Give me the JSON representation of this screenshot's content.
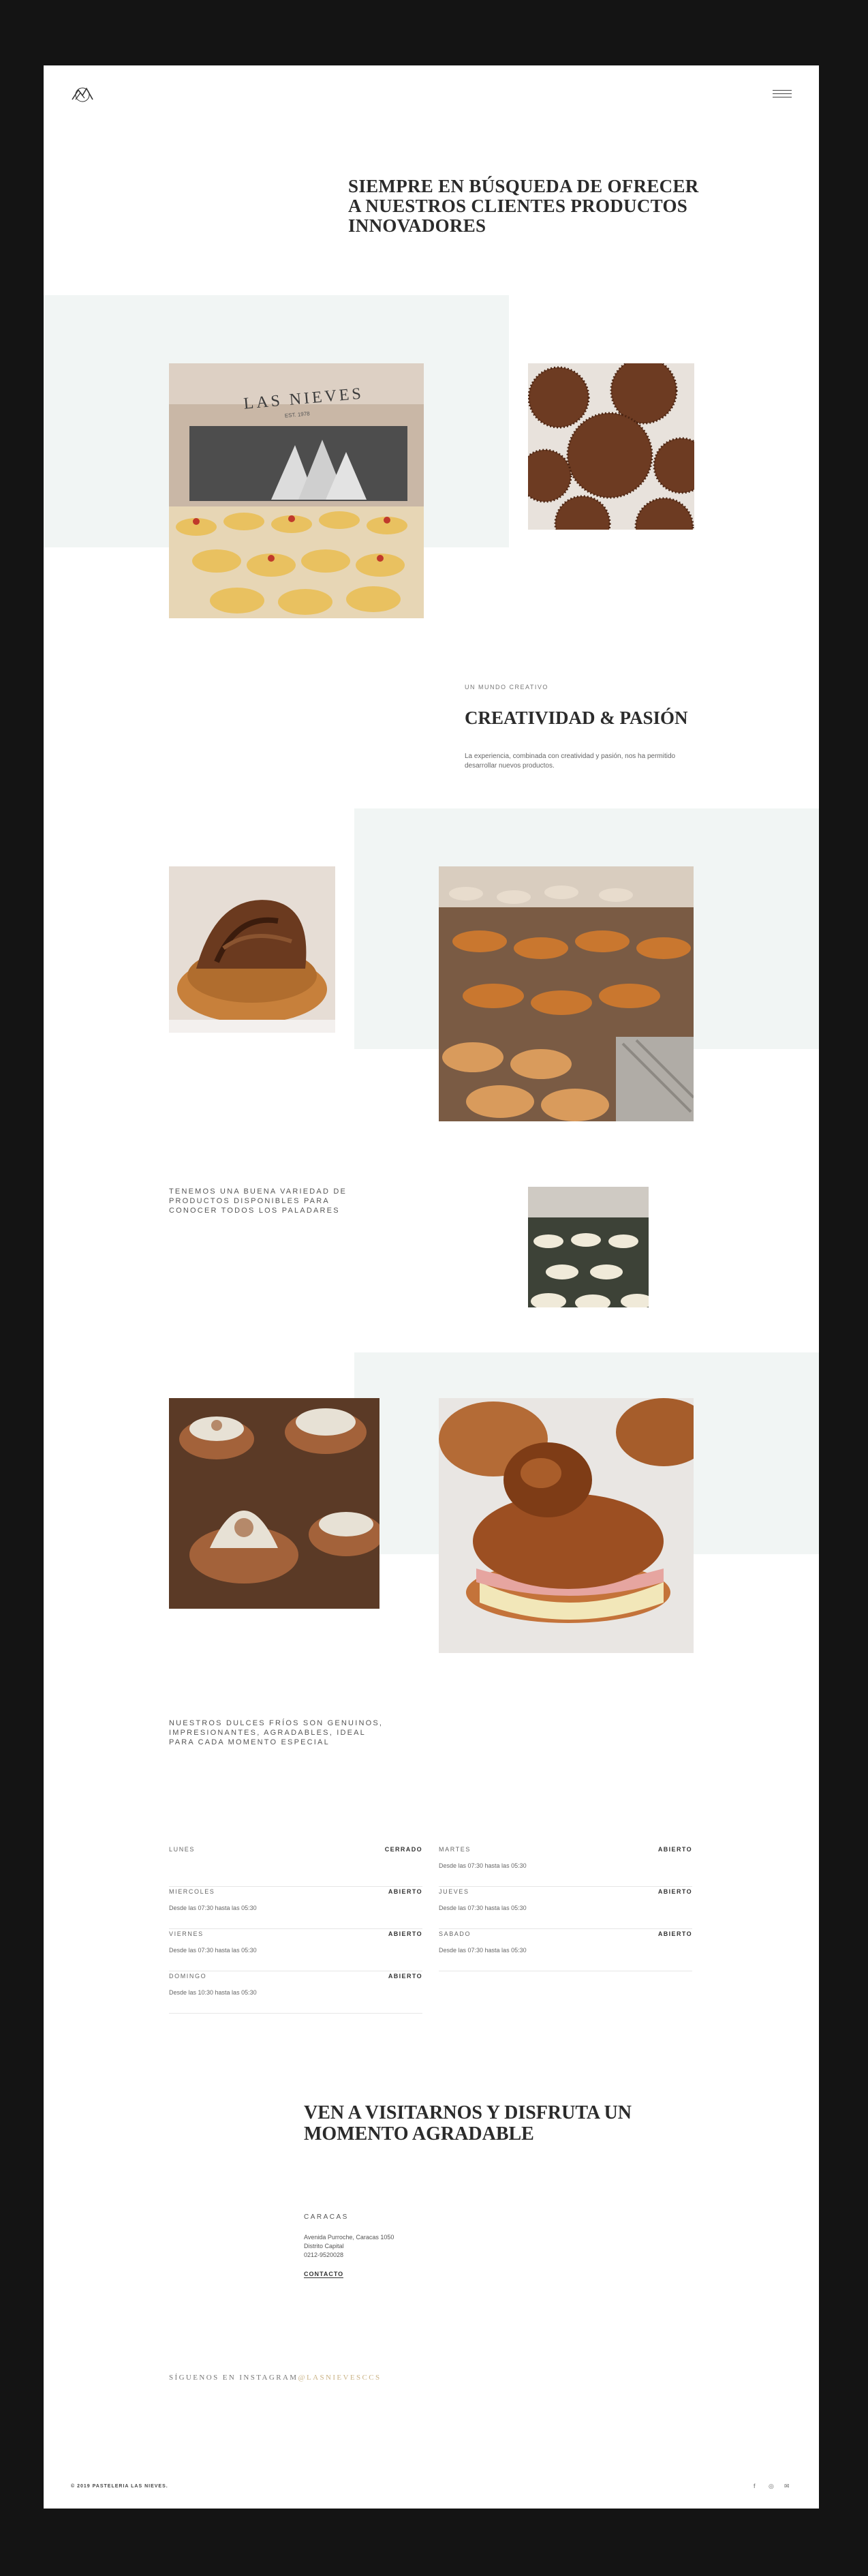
{
  "header": {
    "logo_icon": "mountain-logo-icon",
    "menu_icon": "hamburger-menu-icon"
  },
  "hero": {
    "title": "SIEMPRE EN BÚSQUEDA DE OFRECER A NUESTROS CLIENTES PRODUCTOS INNOVADORES"
  },
  "storefront_sign": {
    "name": "LAS NIEVES",
    "est": "EST. 1978"
  },
  "creative": {
    "label": "UN MUNDO CREATIVO",
    "title": "CREATIVIDAD & PASIÓN",
    "description": "La experiencia, combinada con creatividad y pasión, nos ha permitido desarrollar nuevos productos."
  },
  "variety": {
    "caption": "TENEMOS UNA BUENA VARIEDAD DE PRODUCTOS DISPONIBLES PARA CONOCER TODOS LOS PALADARES"
  },
  "cold_sweets": {
    "caption": "NUESTROS DULCES FRÍOS SON GENUINOS, IMPRESIONANTES, AGRADABLES, IDEAL PARA CADA MOMENTO ESPECIAL"
  },
  "hours": [
    {
      "day": "LUNES",
      "status": "CERRADO",
      "time": ""
    },
    {
      "day": "MARTES",
      "status": "ABIERTO",
      "time": "Desde las 07:30 hasta las 05:30"
    },
    {
      "day": "MIERCOLES",
      "status": "ABIERTO",
      "time": "Desde las 07:30 hasta las 05:30"
    },
    {
      "day": "JUEVES",
      "status": "ABIERTO",
      "time": "Desde las 07:30 hasta las 05:30"
    },
    {
      "day": "VIERNES",
      "status": "ABIERTO",
      "time": "Desde las 07:30 hasta las 05:30"
    },
    {
      "day": "SABADO",
      "status": "ABIERTO",
      "time": "Desde las 07:30 hasta las 05:30"
    },
    {
      "day": "DOMINGO",
      "status": "ABIERTO",
      "time": "Desde las 10:30 hasta las 05:30"
    }
  ],
  "visit": {
    "title": "VEN A VISITARNOS Y DISFRUTA UN MOMENTO AGRADABLE",
    "city": "CARACAS",
    "address_line1": "Avenida Purroche, Caracas 1050",
    "address_line2": "Distrito Capital",
    "phone": "0212-9520028",
    "contact_label": "CONTACTO"
  },
  "instagram": {
    "label": "SÍGUENOS EN INSTAGRAM",
    "handle": "@LASNIEVESCCS"
  },
  "footer": {
    "copyright": "© 2019 PASTELERIA LAS NIEVES.",
    "social_icons": [
      "facebook-icon",
      "instagram-icon",
      "email-icon"
    ],
    "social_glyphs": [
      "f",
      "◎",
      "✉"
    ]
  },
  "colors": {
    "page_bg": "#141414",
    "content_bg": "#ffffff",
    "tint": "#f1f5f4",
    "accent": "#cbb487",
    "text": "#2b2b2b"
  }
}
